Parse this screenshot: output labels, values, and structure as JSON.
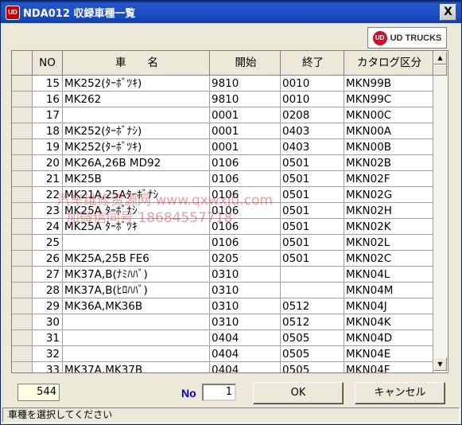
{
  "window": {
    "title": "NDA012 収録車種一覧",
    "app_icon": "UD",
    "close_label": "X"
  },
  "logo": {
    "mark": "UD",
    "text": "UD TRUCKS"
  },
  "table": {
    "columns": [
      "NO",
      "車　　名",
      "開始",
      "終了",
      "カタログ区分"
    ],
    "rows": [
      {
        "no": "15",
        "name": "MK252(ﾀｰﾎﾞﾂｷ)",
        "start": "9810",
        "end": "0010",
        "cat": "MKN99B"
      },
      {
        "no": "16",
        "name": "MK262",
        "start": "9810",
        "end": "0010",
        "cat": "MKN99C"
      },
      {
        "no": "17",
        "name": "",
        "start": "0001",
        "end": "0208",
        "cat": "MKN00C"
      },
      {
        "no": "18",
        "name": "MK252(ﾀｰﾎﾞﾅｼ)",
        "start": "0001",
        "end": "0403",
        "cat": "MKN00A"
      },
      {
        "no": "19",
        "name": "MK252(ﾀｰﾎﾞﾂｷ)",
        "start": "0001",
        "end": "0403",
        "cat": "MKN00B"
      },
      {
        "no": "20",
        "name": "MK26A,26B MD92",
        "start": "0106",
        "end": "0501",
        "cat": "MKN02B"
      },
      {
        "no": "21",
        "name": "MK25B",
        "start": "0106",
        "end": "0501",
        "cat": "MKN02F"
      },
      {
        "no": "22",
        "name": "MK21A,25Aﾀｰﾎﾞﾅｼ",
        "start": "0106",
        "end": "0501",
        "cat": "MKN02G"
      },
      {
        "no": "23",
        "name": "MK25A ﾀｰﾎﾞﾅｼ",
        "start": "0106",
        "end": "0501",
        "cat": "MKN02H"
      },
      {
        "no": "24",
        "name": "MK25A ﾀｰﾎﾞﾂｷ",
        "start": "0106",
        "end": "0501",
        "cat": "MKN02K"
      },
      {
        "no": "25",
        "name": "",
        "start": "0106",
        "end": "0501",
        "cat": "MKN02L"
      },
      {
        "no": "26",
        "name": "MK25A,25B FE6",
        "start": "0205",
        "end": "0501",
        "cat": "MKN02C"
      },
      {
        "no": "27",
        "name": "MK37A,B(ﾅﾐﾊﾊﾞ)",
        "start": "0310",
        "end": "",
        "cat": "MKN04L"
      },
      {
        "no": "28",
        "name": "MK37A,B(ﾋﾛﾊﾊﾞ)",
        "start": "0310",
        "end": "",
        "cat": "MKN04M"
      },
      {
        "no": "29",
        "name": "MK36A,MK36B",
        "start": "0310",
        "end": "0512",
        "cat": "MKN04J"
      },
      {
        "no": "30",
        "name": "",
        "start": "0310",
        "end": "0512",
        "cat": "MKN04K"
      },
      {
        "no": "31",
        "name": "",
        "start": "0404",
        "end": "0505",
        "cat": "MKN04D"
      },
      {
        "no": "32",
        "name": "",
        "start": "0404",
        "end": "0505",
        "cat": "MKN04E"
      },
      {
        "no": "33",
        "name": "MK37A,MK37B",
        "start": "0404",
        "end": "0505",
        "cat": "MKN04F"
      }
    ]
  },
  "scrollbar": {
    "up_icon": "▲",
    "down_icon": "▼"
  },
  "footer": {
    "count": "544",
    "no_label": "No",
    "no_value": "1",
    "ok_label": "OK",
    "cancel_label": "キャンセル"
  },
  "status": {
    "text": "車種を選択してください"
  },
  "watermark": {
    "line1": "汽车维修资源网 www.qxwxju.com",
    "line2": "加微信同号 18684557718"
  }
}
